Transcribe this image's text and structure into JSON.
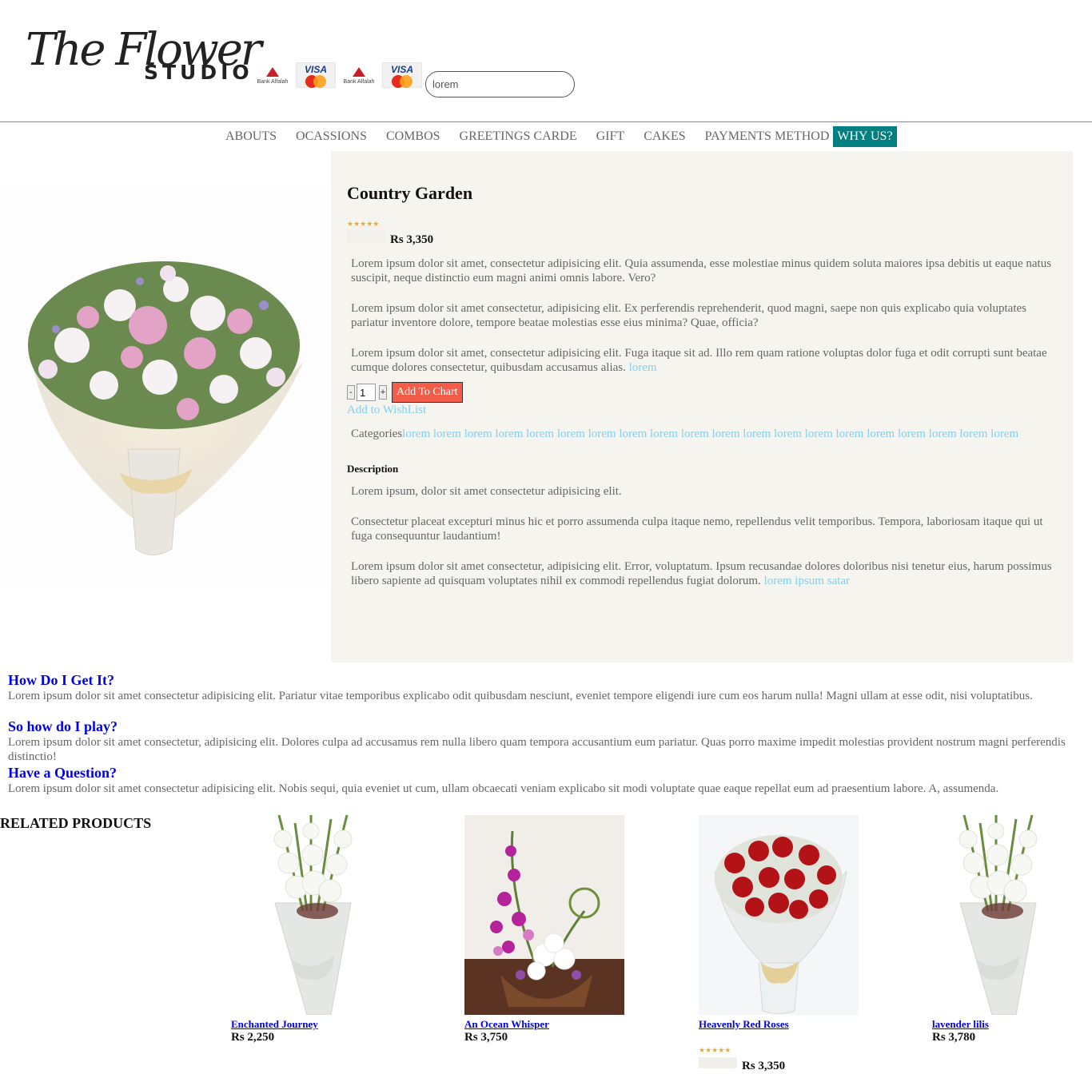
{
  "header": {
    "logo_script": "The Flower",
    "logo_studio": "STUDIO",
    "payments": [
      {
        "bank": "Bank Alfalah",
        "card": "VISA"
      },
      {
        "bank": "Bank Alfalah",
        "card": "VISA"
      }
    ],
    "search_value": "lorem"
  },
  "nav": {
    "items": [
      "ABOUTS",
      "OCASSIONS",
      "COMBOS",
      "GREETINGS CARDE",
      "GIFT",
      "CAKES",
      "PAYMENTS METHOD",
      "WHY US?"
    ],
    "active_index": 7,
    "active_color": "#008080"
  },
  "product": {
    "title": "Country Garden",
    "rating_stars": "★★★★★",
    "price": "Rs 3,350",
    "paragraphs": [
      "Lorem ipsum dolor sit amet, consectetur adipisicing elit. Quia assumenda, esse molestiae minus quidem soluta maiores ipsa debitis ut eaque natus suscipit, neque distinctio eum magni animi omnis labore. Vero?",
      "Lorem ipsum dolor sit amet consectetur, adipisicing elit. Ex perferendis reprehenderit, quod magni, saepe non quis explicabo quia voluptates pariatur inventore dolore, tempore beatae molestias esse eius minima? Quae, officia?",
      "Lorem ipsum dolor sit amet, consectetur adipisicing elit. Fuga itaque sit ad. Illo rem quam ratione voluptas dolor fuga et odit corrupti sunt beatae cumque dolores consectetur, quibusdam accusamus alias."
    ],
    "paragraph_link": "lorem",
    "qty_minus": "-",
    "qty_value": "1",
    "qty_plus": "+",
    "add_to_cart": "Add To Chart",
    "add_to_wishlist": "Add to WishList",
    "categories_label": "Categories",
    "categories_links": "lorem lorem lorem lorem lorem lorem lorem lorem lorem lorem lorem lorem lorem lorem lorem lorem lorem lorem lorem lorem",
    "description_label": "Description",
    "description": [
      "Lorem ipsum, dolor sit amet consectetur adipisicing elit.",
      "Consectetur placeat excepturi minus hic et porro assumenda culpa itaque nemo, repellendus velit temporibus. Tempora, laboriosam itaque qui ut fuga consequuntur laudantium!",
      "Lorem ipsum dolor sit amet consectetur, adipisicing elit. Error, voluptatum. Ipsum recusandae dolores doloribus nisi tenetur eius, harum possimus libero sapiente ad quisquam voluptates nihil ex commodi repellendus fugiat dolorum."
    ],
    "description_link": "lorem ipsum satar",
    "add_button_color": "#f45c4a",
    "link_color": "#87ceeb"
  },
  "faq": [
    {
      "q": "How Do I Get It?",
      "a": "Lorem ipsum dolor sit amet consectetur adipisicing elit. Pariatur vitae temporibus explicabo odit quibusdam nesciunt, eveniet tempore eligendi iure cum eos harum nulla! Magni ullam at esse odit, nisi voluptatibus."
    },
    {
      "q": "So how do I play?",
      "a": "Lorem ipsum dolor sit amet consectetur, adipisicing elit. Dolores culpa ad accusamus rem nulla libero quam tempora accusantium eum pariatur. Quas porro maxime impedit molestias provident nostrum magni perferendis distinctio!"
    },
    {
      "q": "Have a Question?",
      "a": "Lorem ipsum dolor sit amet consectetur adipisicing elit. Nobis sequi, quia eveniet ut cum, ullam obcaecati veniam explicabo sit modi voluptate quae eaque repellat eum ad praesentium labore. A, assumenda."
    }
  ],
  "related": {
    "title": "RELATED PRODUCTS",
    "products": [
      {
        "name": "Enchanted Journey",
        "price": "Rs 2,250"
      },
      {
        "name": "An Ocean Whisper",
        "price": "Rs 3,750"
      },
      {
        "name": "Heavenly Red Roses",
        "price": "Rs 3,350",
        "rating_stars": "★★★★★"
      },
      {
        "name": "lavender lilis",
        "price": "Rs 3,780"
      }
    ]
  }
}
